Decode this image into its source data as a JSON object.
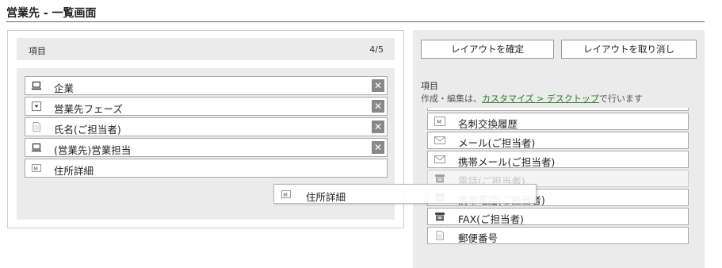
{
  "page": {
    "title": "営業先 - 一覧画面"
  },
  "left": {
    "header_label": "項目",
    "count": "4/5",
    "items": [
      {
        "label": "企業",
        "icon": "laptop-icon",
        "removable": true
      },
      {
        "label": "営業先フェーズ",
        "icon": "dropdown-icon",
        "removable": true
      },
      {
        "label": "氏名(ご担当者)",
        "icon": "document-icon",
        "removable": true
      },
      {
        "label": "(営業先)営業担当",
        "icon": "laptop-icon",
        "removable": true
      },
      {
        "label": "住所詳細",
        "icon": "address-card-icon",
        "removable": false
      }
    ],
    "remove_glyph": "✕"
  },
  "drag": {
    "label": "住所詳細",
    "icon": "address-card-icon"
  },
  "right": {
    "confirm_label": "レイアウトを確定",
    "cancel_label": "レイアウトを取り消し",
    "section_label": "項目",
    "note_prefix": "作成・編集は、",
    "note_link": "カスタマイズ > デスクトップ",
    "note_suffix": "で行います",
    "items": [
      {
        "label": "名刺交換履歴",
        "icon": "address-card-icon"
      },
      {
        "label": "メール(ご担当者)",
        "icon": "envelope-icon"
      },
      {
        "label": "携帯メール(ご担当者)",
        "icon": "envelope-icon"
      },
      {
        "label": "電話(ご担当者)",
        "icon": "phone-icon"
      },
      {
        "label": "携帯電話(ご担当者)",
        "icon": "phone-icon"
      },
      {
        "label": "FAX(ご担当者)",
        "icon": "phone-icon"
      },
      {
        "label": "郵便番号",
        "icon": "document-icon"
      }
    ]
  },
  "colors": {
    "panel_bg": "#ebebeb",
    "link": "#2a7a2a",
    "remove_bg": "#888888"
  }
}
